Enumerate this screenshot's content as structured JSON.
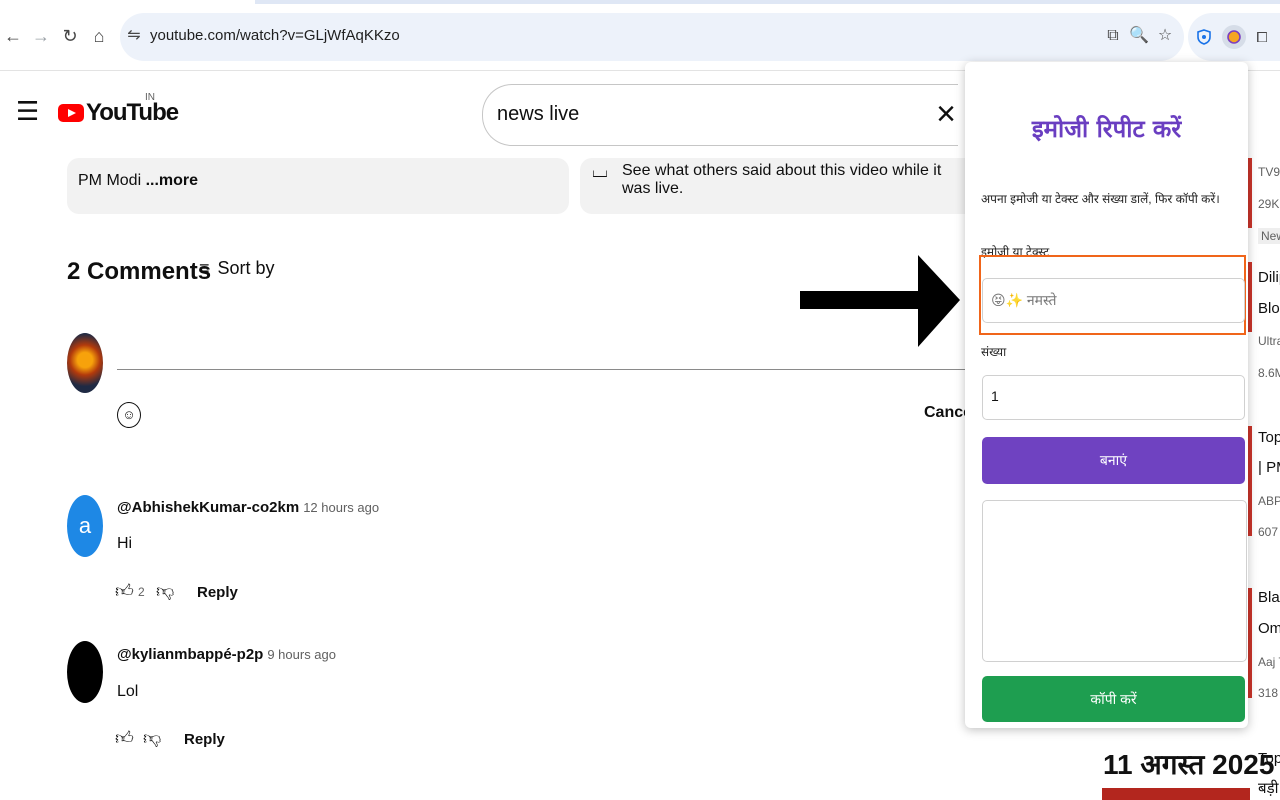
{
  "browser": {
    "url": "youtube.com/watch?v=GLjWfAqKKzo",
    "icons": {
      "back": "←",
      "forward": "→",
      "reload": "↻",
      "home": "⌂",
      "site_info": "⇋",
      "install": "⧉",
      "zoom": "🔍",
      "star": "☆",
      "extensions": "⧠"
    }
  },
  "youtube": {
    "brand": "YouTube",
    "country": "IN",
    "search_value": "news live",
    "description_snippet": "PM Modi",
    "more_label": "...more",
    "live_chat_text": "See what others said about this video while it was live.",
    "comments_count_label": "2 Comments",
    "sort_label": "Sort by",
    "cancel_label": "Cancel",
    "comments": [
      {
        "avatar_letter": "a",
        "avatar_color": "#1e88e5",
        "author": "@AbhishekKumar-co2km",
        "time": "12 hours ago",
        "text": "Hi",
        "likes": "2",
        "reply_label": "Reply"
      },
      {
        "avatar_letter": "",
        "avatar_color": "#000000",
        "author": "@kylianmbappé-p2p",
        "time": "9 hours ago",
        "text": "Lol",
        "likes": "",
        "reply_label": "Reply"
      }
    ],
    "recommendations": [
      {
        "line1": "TV9",
        "line2": "29K",
        "badge": "New"
      },
      {
        "line1": "Dilip",
        "line2": "Bloc",
        "ch": "Ultra",
        "views": "8.6M"
      },
      {
        "line1": "Top",
        "line2": "| PM",
        "ch": "ABP",
        "views": "607"
      },
      {
        "line1": "Blac",
        "line2": "Om",
        "ch": "Aaj T",
        "views": "318"
      },
      {
        "line1": "Top",
        "line2": "बड़ी"
      }
    ],
    "date_banner": "11 अगस्त 2025"
  },
  "extension": {
    "title": "इमोजी रिपीट करें",
    "description": "अपना इमोजी या टेक्स्ट और संख्या डालें, फिर कॉपी करें।",
    "text_label": "इमोजी या टेक्स्ट",
    "text_placeholder": "😝✨ नमस्ते",
    "count_label": "संख्या",
    "count_value": "1",
    "make_button": "बनाएं",
    "copy_button": "कॉपी करें",
    "accent_color": "#6f42c1",
    "copy_color": "#1e9e50",
    "highlight_color": "#f0651a"
  }
}
